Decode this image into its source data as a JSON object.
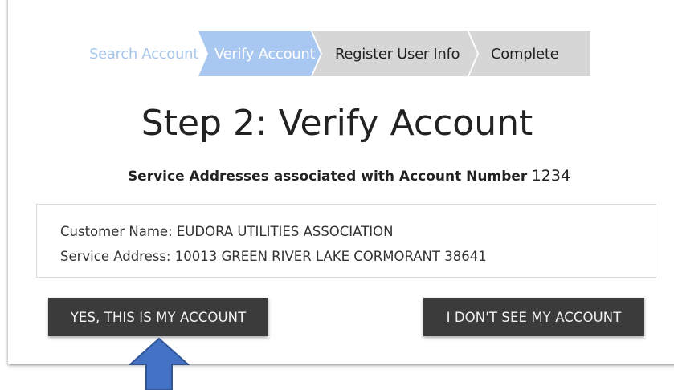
{
  "stepper": {
    "steps": [
      {
        "label": "Search Account",
        "state": "done"
      },
      {
        "label": "Verify Account",
        "state": "active"
      },
      {
        "label": "Register User Info",
        "state": "pending"
      },
      {
        "label": "Complete",
        "state": "pending"
      }
    ]
  },
  "heading": "Step 2: Verify Account",
  "subtitle": {
    "label": "Service Addresses associated with Account Number",
    "account_number": "1234"
  },
  "account": {
    "customer_name_line": "Customer Name: EUDORA UTILITIES ASSOCIATION",
    "service_address_line": "Service Address: 10013 GREEN RIVER LAKE CORMORANT 38641"
  },
  "buttons": {
    "confirm": "YES, THIS IS MY ACCOUNT",
    "deny": "I DON'T SEE MY ACCOUNT"
  },
  "colors": {
    "active_step": "#a9c8f1",
    "pending_step": "#d6d6d6",
    "button_bg": "#3b3b3b",
    "arrow_fill": "#4472c4"
  },
  "annotation": {
    "icon": "up-arrow-icon"
  }
}
